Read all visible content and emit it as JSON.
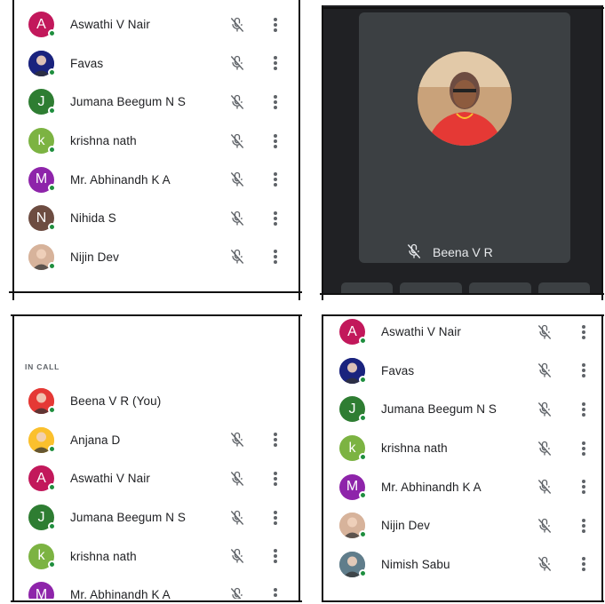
{
  "top_left_panel": {
    "participants": [
      {
        "name": "Aswathi V Nair",
        "initial": "A",
        "color": "#c2185b",
        "avatar": "letter"
      },
      {
        "name": "Favas",
        "initial": "",
        "color": "#1a237e",
        "avatar": "photo"
      },
      {
        "name": "Jumana Beegum N S",
        "initial": "J",
        "color": "#2e7d32",
        "avatar": "letter"
      },
      {
        "name": "krishna nath",
        "initial": "k",
        "color": "#7cb342",
        "avatar": "letter"
      },
      {
        "name": "Mr. Abhinandh K A",
        "initial": "M",
        "color": "#8e24aa",
        "avatar": "letter"
      },
      {
        "name": "Nihida S",
        "initial": "N",
        "color": "#6d4c41",
        "avatar": "letter"
      },
      {
        "name": "Nijin Dev",
        "initial": "",
        "color": "#d7b39b",
        "avatar": "photo"
      }
    ]
  },
  "top_right_panel": {
    "speaker_name": "Beena V R",
    "avatar_colors": {
      "background": "#c9a27a",
      "saree": "#e53935"
    }
  },
  "bottom_left_panel": {
    "section_label": "IN CALL",
    "participants": [
      {
        "name": "Beena V R (You)",
        "initial": "",
        "color": "#e53935",
        "avatar": "photo",
        "is_self": true
      },
      {
        "name": "Anjana D",
        "initial": "",
        "color": "#fbc02d",
        "avatar": "photo"
      },
      {
        "name": "Aswathi V Nair",
        "initial": "A",
        "color": "#c2185b",
        "avatar": "letter"
      },
      {
        "name": "Jumana Beegum N S",
        "initial": "J",
        "color": "#2e7d32",
        "avatar": "letter"
      },
      {
        "name": "krishna nath",
        "initial": "k",
        "color": "#7cb342",
        "avatar": "letter"
      },
      {
        "name": "Mr. Abhinandh K A",
        "initial": "M",
        "color": "#8e24aa",
        "avatar": "letter"
      }
    ]
  },
  "bottom_right_panel": {
    "participants": [
      {
        "name": "Aswathi V Nair",
        "initial": "A",
        "color": "#c2185b",
        "avatar": "letter"
      },
      {
        "name": "Favas",
        "initial": "",
        "color": "#1a237e",
        "avatar": "photo"
      },
      {
        "name": "Jumana Beegum N S",
        "initial": "J",
        "color": "#2e7d32",
        "avatar": "letter"
      },
      {
        "name": "krishna nath",
        "initial": "k",
        "color": "#7cb342",
        "avatar": "letter"
      },
      {
        "name": "Mr. Abhinandh K A",
        "initial": "M",
        "color": "#8e24aa",
        "avatar": "letter"
      },
      {
        "name": "Nijin Dev",
        "initial": "",
        "color": "#d7b39b",
        "avatar": "photo"
      },
      {
        "name": "Nimish Sabu",
        "initial": "",
        "color": "#607d8b",
        "avatar": "photo"
      }
    ]
  },
  "icons": {
    "mic": "mic-off-icon",
    "menu": "more-vert-icon",
    "status": "online-dot"
  }
}
